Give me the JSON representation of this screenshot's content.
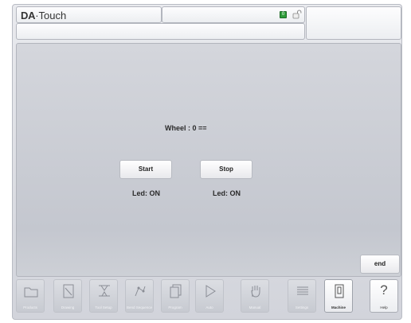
{
  "header": {
    "brand_prefix": "DA",
    "brand_suffix": "·Touch",
    "status_led_value": "0"
  },
  "main": {
    "wheel_text": "Wheel : 0 ==",
    "start_button": "Start",
    "stop_button": "Stop",
    "start_led": "Led: ON",
    "stop_led": "Led: ON",
    "end_button": "end"
  },
  "tabs": [
    {
      "label": "Products",
      "icon": "folder-icon"
    },
    {
      "label": "Drawing",
      "icon": "drawing-icon"
    },
    {
      "label": "Tool Setup",
      "icon": "tool-setup-icon"
    },
    {
      "label": "Bend Sequence",
      "icon": "bend-sequence-icon"
    },
    {
      "label": "Program",
      "icon": "program-icon"
    },
    {
      "label": "Auto",
      "icon": "play-icon"
    },
    {
      "label": "Manual",
      "icon": "hand-icon"
    },
    {
      "label": "Settings",
      "icon": "settings-icon"
    },
    {
      "label": "Machine",
      "icon": "machine-icon",
      "active": true
    },
    {
      "label": "Help",
      "icon": "help-icon"
    }
  ],
  "colors": {
    "status_led": "#2e9c3a",
    "background": "#d2d4db"
  }
}
